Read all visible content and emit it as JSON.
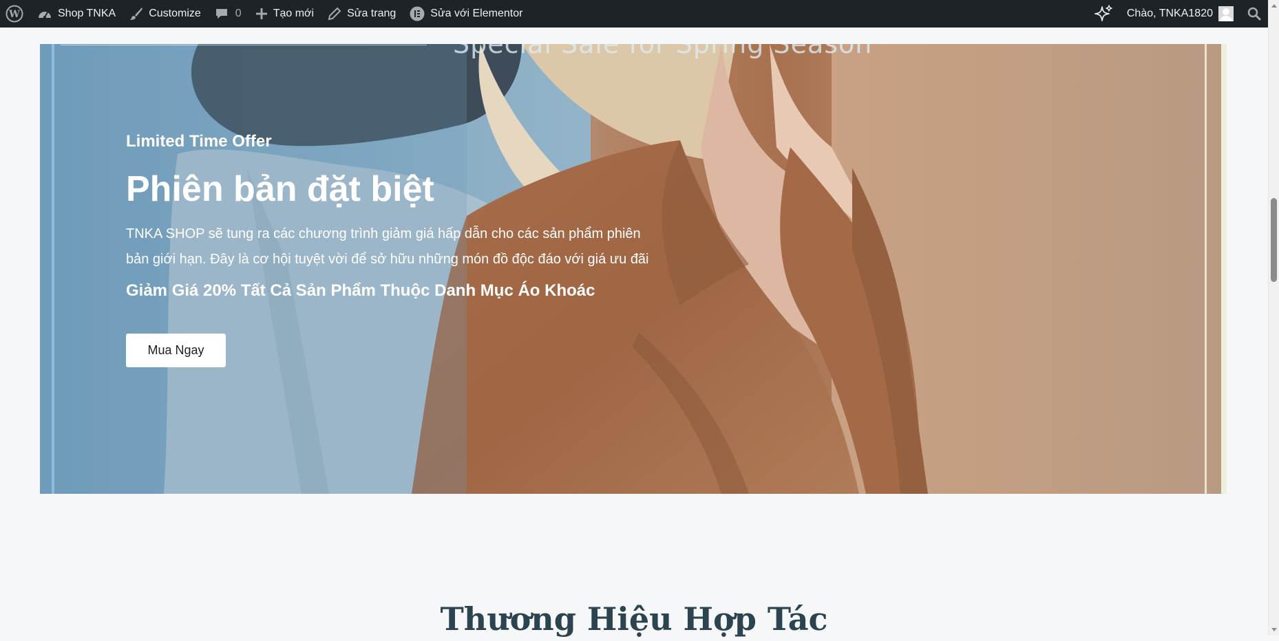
{
  "admin_bar": {
    "site_name": "Shop TNKA",
    "customize": "Customize",
    "comments_count": "0",
    "new_label": "Tạo mới",
    "edit_page": "Sửa trang",
    "edit_elementor": "Sửa với Elementor",
    "greeting": "Chào, TNKA1820"
  },
  "banner": {
    "season_text": "Special Sale for Spring Season",
    "offer_label": "Limited Time Offer",
    "headline": "Phiên bản đặt biệt",
    "description": "TNKA SHOP sẽ tung ra các chương trình giảm giá hấp dẫn cho các sản phẩm phiên bản giới hạn. Đây là cơ hội tuyệt vời để sở hữu những món đồ độc đáo với giá ưu đãi",
    "discount": "Giảm Giá 20% Tất Cả Sản Phẩm Thuộc Danh Mục Áo Khoác",
    "button_label": "Mua Ngay"
  },
  "section": {
    "title": "Thương Hiệu Hợp Tác"
  },
  "colors": {
    "admin_bar_bg": "#1d2327",
    "admin_bar_text": "#f0f0f1",
    "page_bg": "#f6f7f9",
    "heading_color": "#2c4350",
    "button_bg": "#ffffff"
  },
  "icons": [
    "wordpress-icon",
    "dashboard-icon",
    "brush-icon",
    "comment-icon",
    "plus-icon",
    "pencil-icon",
    "elementor-icon",
    "sparkle-icon",
    "search-icon"
  ]
}
